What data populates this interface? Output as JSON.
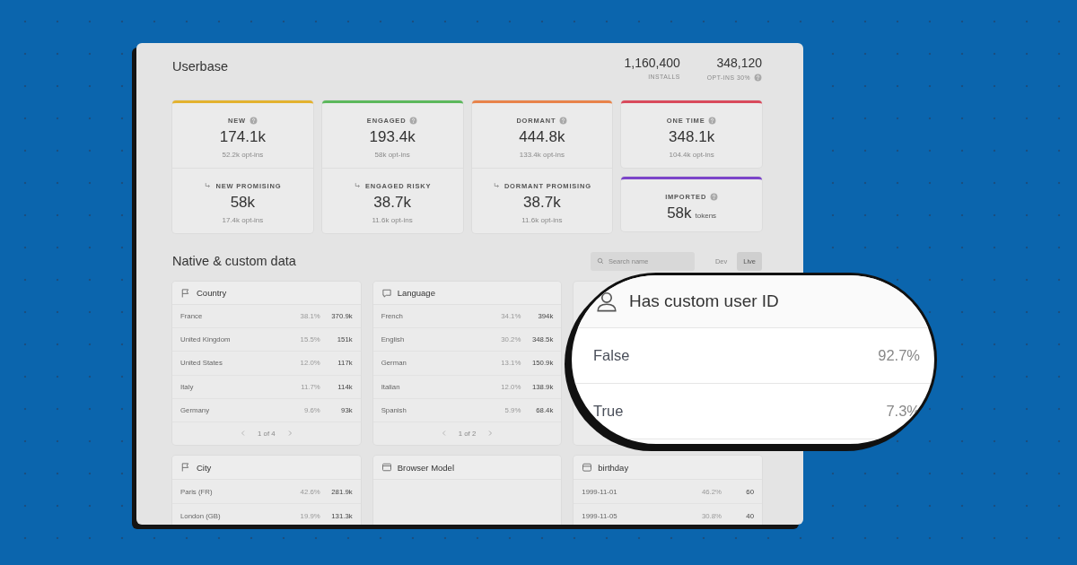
{
  "userbase": {
    "title": "Userbase",
    "stats": [
      {
        "value": "1,160,400",
        "label": "INSTALLS",
        "help": false
      },
      {
        "value": "348,120",
        "label": "OPT-INS 30%",
        "help": true
      }
    ]
  },
  "segment_columns": [
    {
      "cards": [
        {
          "color": "#e3b22f",
          "label": "NEW",
          "value": "174.1k",
          "sub": "52.2k opt-ins",
          "child": {
            "label": "NEW PROMISING",
            "value": "58k",
            "sub": "17.4k opt-ins"
          }
        }
      ]
    },
    {
      "cards": [
        {
          "color": "#5cb85c",
          "label": "ENGAGED",
          "value": "193.4k",
          "sub": "58k opt-ins",
          "child": {
            "label": "ENGAGED RISKY",
            "value": "38.7k",
            "sub": "11.6k opt-ins"
          }
        }
      ]
    },
    {
      "cards": [
        {
          "color": "#e8834a",
          "label": "DORMANT",
          "value": "444.8k",
          "sub": "133.4k opt-ins",
          "child": {
            "label": "DORMANT PROMISING",
            "value": "38.7k",
            "sub": "11.6k opt-ins"
          }
        }
      ]
    },
    {
      "cards": [
        {
          "color": "#d94a5c",
          "label": "ONE TIME",
          "value": "348.1k",
          "sub": "104.4k opt-ins"
        },
        {
          "color": "#7b44c9",
          "label": "IMPORTED",
          "value": "58k",
          "unit": "tokens"
        }
      ]
    }
  ],
  "data_section": {
    "title": "Native & custom data",
    "search": {
      "placeholder": "Search name"
    },
    "modes": [
      {
        "label": "Dev",
        "selected": false
      },
      {
        "label": "Live",
        "selected": true
      }
    ]
  },
  "tables": [
    {
      "kind": "flag",
      "title": "Country",
      "pager": "1 of 4",
      "rows": [
        {
          "name": "France",
          "share": "38.1%",
          "count": "370.9k"
        },
        {
          "name": "United Kingdom",
          "share": "15.5%",
          "count": "151k"
        },
        {
          "name": "United States",
          "share": "12.0%",
          "count": "117k"
        },
        {
          "name": "Italy",
          "share": "11.7%",
          "count": "114k"
        },
        {
          "name": "Germany",
          "share": "9.6%",
          "count": "93k"
        }
      ]
    },
    {
      "kind": "chat",
      "title": "Language",
      "pager": "1 of 2",
      "rows": [
        {
          "name": "French",
          "share": "34.1%",
          "count": "394k"
        },
        {
          "name": "English",
          "share": "30.2%",
          "count": "348.5k"
        },
        {
          "name": "German",
          "share": "13.1%",
          "count": "150.9k"
        },
        {
          "name": "Italian",
          "share": "12.0%",
          "count": "138.9k"
        },
        {
          "name": "Spanish",
          "share": "5.9%",
          "count": "68.4k"
        }
      ]
    },
    {
      "kind": "covered"
    },
    {
      "kind": "flag",
      "title": "City",
      "rows": [
        {
          "name": "Paris (FR)",
          "share": "42.6%",
          "count": "281.9k"
        },
        {
          "name": "London (GB)",
          "share": "19.9%",
          "count": "131.3k"
        }
      ]
    },
    {
      "kind": "window",
      "title": "Browser Model"
    },
    {
      "kind": "calendar",
      "title": "birthday",
      "rows": [
        {
          "name": "1999-11-01",
          "share": "46.2%",
          "count": "60"
        },
        {
          "name": "1999-11-05",
          "share": "30.8%",
          "count": "40"
        }
      ]
    }
  ],
  "magnifier": {
    "title": "Has custom user ID",
    "rows": [
      {
        "name": "False",
        "share": "92.7%"
      },
      {
        "name": "True",
        "share": "7.3%"
      }
    ]
  }
}
